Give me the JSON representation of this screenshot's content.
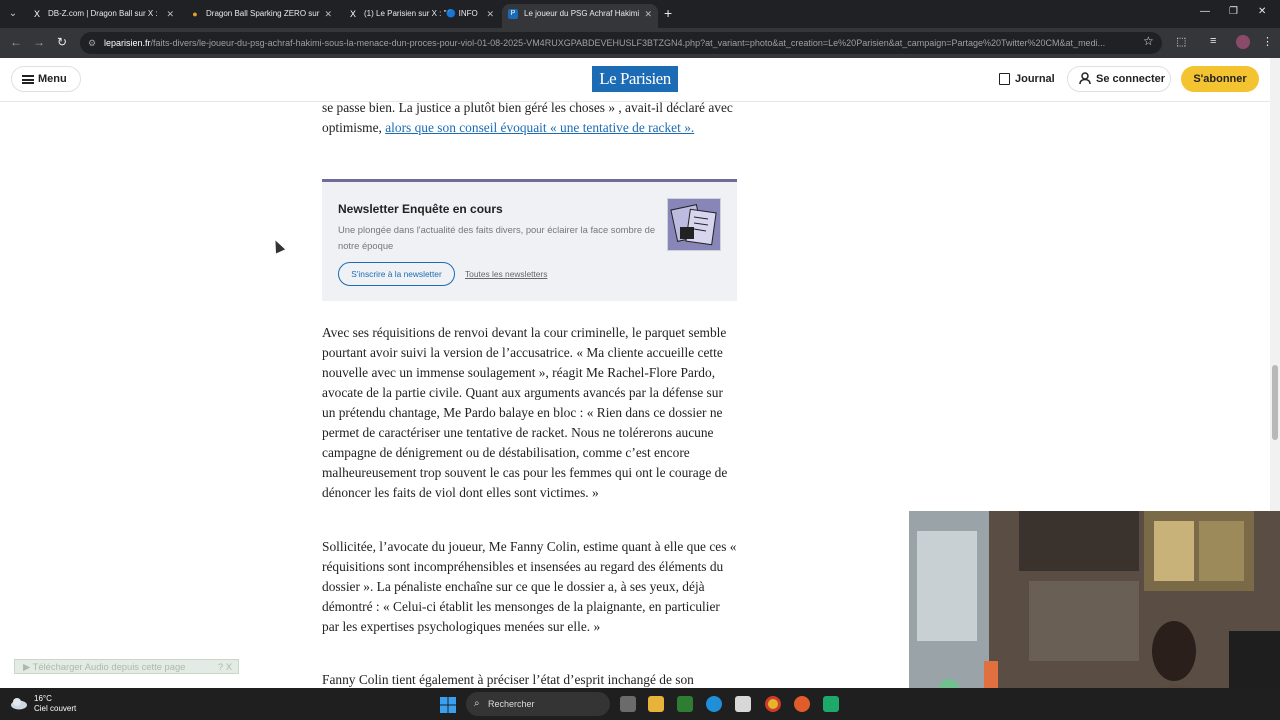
{
  "browser": {
    "tabs": [
      {
        "title": "DB-Z.com | Dragon Ball sur X :",
        "icon": "x-icon"
      },
      {
        "title": "Dragon Ball Sparking ZERO sur",
        "icon": "dot-icon"
      },
      {
        "title": "(1) Le Parisien sur X : \"🔵 INFO",
        "icon": "x-icon"
      },
      {
        "title": "Le joueur du PSG Achraf Hakimi",
        "icon": "parisien-icon"
      }
    ],
    "url_host": "leparisien.fr",
    "url_path": "/faits-divers/le-joueur-du-psg-achraf-hakimi-sous-la-menace-dun-proces-pour-viol-01-08-2025-VM4RUXGPABDEVEHUSLF3BTZGN4.php?at_variant=photo&at_creation=Le%20Parisien&at_campaign=Partage%20Twitter%20CM&at_medi..."
  },
  "site_header": {
    "menu_label": "Menu",
    "logo": "Le Parisien",
    "journal_label": "Journal",
    "connect_label": "Se connecter",
    "subscribe_label": "S'abonner"
  },
  "article": {
    "p_top_before": "se passe bien. La justice a plutôt bien géré les choses » , avait-il déclaré avec optimisme, ",
    "p_top_link": "alors que son conseil évoquait « une tentative de racket ».",
    "p2": "Avec ses réquisitions de renvoi devant la cour criminelle, le parquet semble pourtant avoir suivi la version de l’accusatrice. « Ma cliente accueille cette nouvelle avec un immense soulagement », réagit Me Rachel-Flore Pardo, avocate de la partie civile. Quant aux arguments avancés par la défense sur un prétendu chantage, Me Pardo balaye en bloc : « Rien dans ce dossier ne permet de caractériser une tentative de racket. Nous ne tolérerons aucune campagne de dénigrement ou de déstabilisation, comme c’est encore malheureusement trop souvent le cas pour les femmes qui ont le courage de dénoncer les faits de viol dont elles sont victimes. »",
    "p3": "Sollicitée, l’avocate du joueur, Me Fanny Colin, estime quant à elle que ces « réquisitions sont incompréhensibles et insensées au regard des éléments du dossier ». La pénaliste enchaîne sur ce que le dossier a, à ses yeux, déjà démontré : « Celui-ci établit les mensonges de la plaignante, en particulier par les expertises psychologiques menées sur elle. »",
    "p4": "Fanny Colin tient également à préciser l’état d’esprit inchangé de son"
  },
  "newsletter": {
    "title": "Newsletter Enquête en cours",
    "description": "Une plongée dans l'actualité des faits divers, pour éclairer la face sombre de notre époque",
    "subscribe_button": "S'inscrire à la newsletter",
    "all_link": "Toutes les newsletters"
  },
  "audio_toolbar": {
    "label": "Télécharger Audio depuis cette page",
    "controls": "? X"
  },
  "taskbar": {
    "temperature": "16°C",
    "weather": "Ciel couvert",
    "search_placeholder": "Rechercher"
  },
  "colors": {
    "brand_blue": "#1c6bb5",
    "subscribe_yellow": "#f4c430",
    "newsletter_accent": "#6f6b9b"
  }
}
